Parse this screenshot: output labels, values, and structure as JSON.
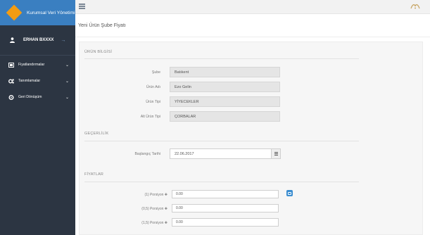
{
  "brand": {
    "title": "Kurumsal Veri Yönetimi"
  },
  "user": {
    "name": "ERHAN BXXXX",
    "arrow": "→"
  },
  "sidebar": {
    "items": [
      {
        "label": "Fiyatlandırmalar",
        "chevron": "⌄"
      },
      {
        "label": "Tanımlamalar",
        "chevron": "⌄"
      },
      {
        "label": "Geri Dönüşüm",
        "chevron": "⌄"
      }
    ]
  },
  "page": {
    "title": "Yeni Ürün Şube Fiyatı"
  },
  "product_info": {
    "section_title": "ÜRÜN BİLGİSİ",
    "fields": [
      {
        "label": "Şube",
        "value": "Batıkent"
      },
      {
        "label": "Ürün Adı",
        "value": "Ezo Gelin"
      },
      {
        "label": "Ürün Tipi",
        "value": "YİYECEKLER"
      },
      {
        "label": "Alt Ürün Tipi",
        "value": "ÇORBALAR"
      }
    ]
  },
  "validity": {
    "section_title": "GEÇERLİLİK",
    "start_label": "Başlangıç Tarihi",
    "start_value": "22.06.2017"
  },
  "prices": {
    "section_title": "FİYATLAR",
    "rows": [
      {
        "label": "(1) Porsiyon ✚",
        "value": "0.00"
      },
      {
        "label": "(0,5) Porsiyon ✚",
        "value": "0.00"
      },
      {
        "label": "(1,5) Porsiyon ✚",
        "value": "0.00"
      }
    ]
  },
  "colors": {
    "sidebar": "#2c3542",
    "brand": "#3a7fc1",
    "accent": "#3b8dd0"
  }
}
